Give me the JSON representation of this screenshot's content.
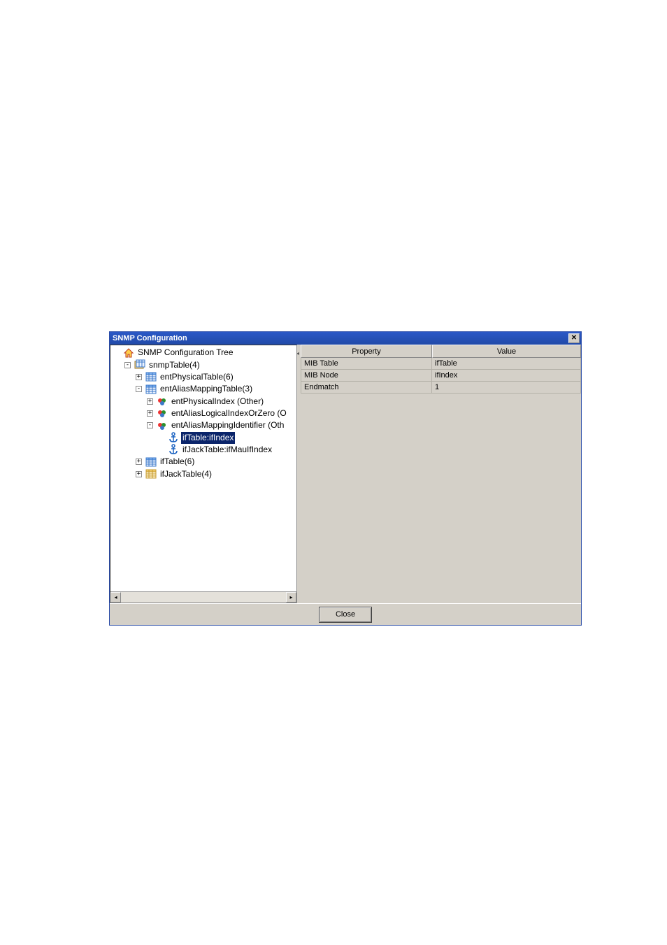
{
  "window": {
    "title": "SNMP Configuration"
  },
  "tree": {
    "root_label": "SNMP Configuration Tree",
    "nodes": {
      "snmpTable": "snmpTable(4)",
      "entPhysicalTable": "entPhysicalTable(6)",
      "entAliasMappingTable": "entAliasMappingTable(3)",
      "entPhysicalIndex": "entPhysicalIndex (Other)",
      "entAliasLogicalIndexOrZero": "entAliasLogicalIndexOrZero (O",
      "entAliasMappingIdentifier": "entAliasMappingIdentifier (Oth",
      "ifTable_ifIndex": "ifTable:ifIndex",
      "ifJackTable_ifMauIfIndex": "ifJackTable:ifMauIfIndex",
      "ifTable": "ifTable(6)",
      "ifJackTable": "ifJackTable(4)"
    }
  },
  "propTable": {
    "header_property": "Property",
    "header_value": "Value",
    "rows": [
      {
        "property": "MIB Table",
        "value": "ifTable"
      },
      {
        "property": "MIB Node",
        "value": "ifIndex"
      },
      {
        "property": "Endmatch",
        "value": "1"
      }
    ]
  },
  "buttons": {
    "close": "Close"
  }
}
